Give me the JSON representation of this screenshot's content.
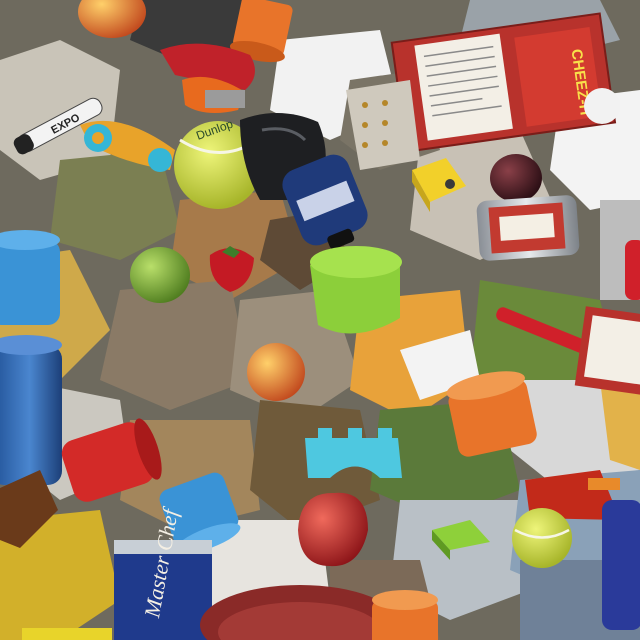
{
  "scene": {
    "kind": "synthetic-object-clutter",
    "objects": [
      "peach",
      "red-clamp",
      "orange-cup",
      "food-box",
      "screwdriver-toy",
      "marker",
      "tennis-ball",
      "black-bag",
      "blue-bottle",
      "yellow-cube",
      "plum",
      "soup-can",
      "blue-cup",
      "lime",
      "strawberry",
      "green-cup",
      "red-screwdriver",
      "blue-cylinder",
      "red-cup",
      "brown-block",
      "cyan-block",
      "orange-cup-2",
      "blue-cup-2",
      "red-apple",
      "coffee-can",
      "red-mustard-bottle",
      "green-block",
      "tennis-ball-2",
      "red-plate",
      "orange-cup-3"
    ]
  },
  "labels": {
    "food_box": "CHEEZ-IT",
    "marker": "EXPO",
    "coffee_can": "Master Chef",
    "tennis_ball": "Dunlop"
  },
  "colors": {
    "background": "#6e6a5e",
    "cup_orange": "#e8742a",
    "cup_green": "#8ccf3a",
    "cup_blue": "#3a93d6",
    "box_red": "#b8322c",
    "ball_yellow": "#cfe03a",
    "can_blue": "#1f3a8c"
  }
}
